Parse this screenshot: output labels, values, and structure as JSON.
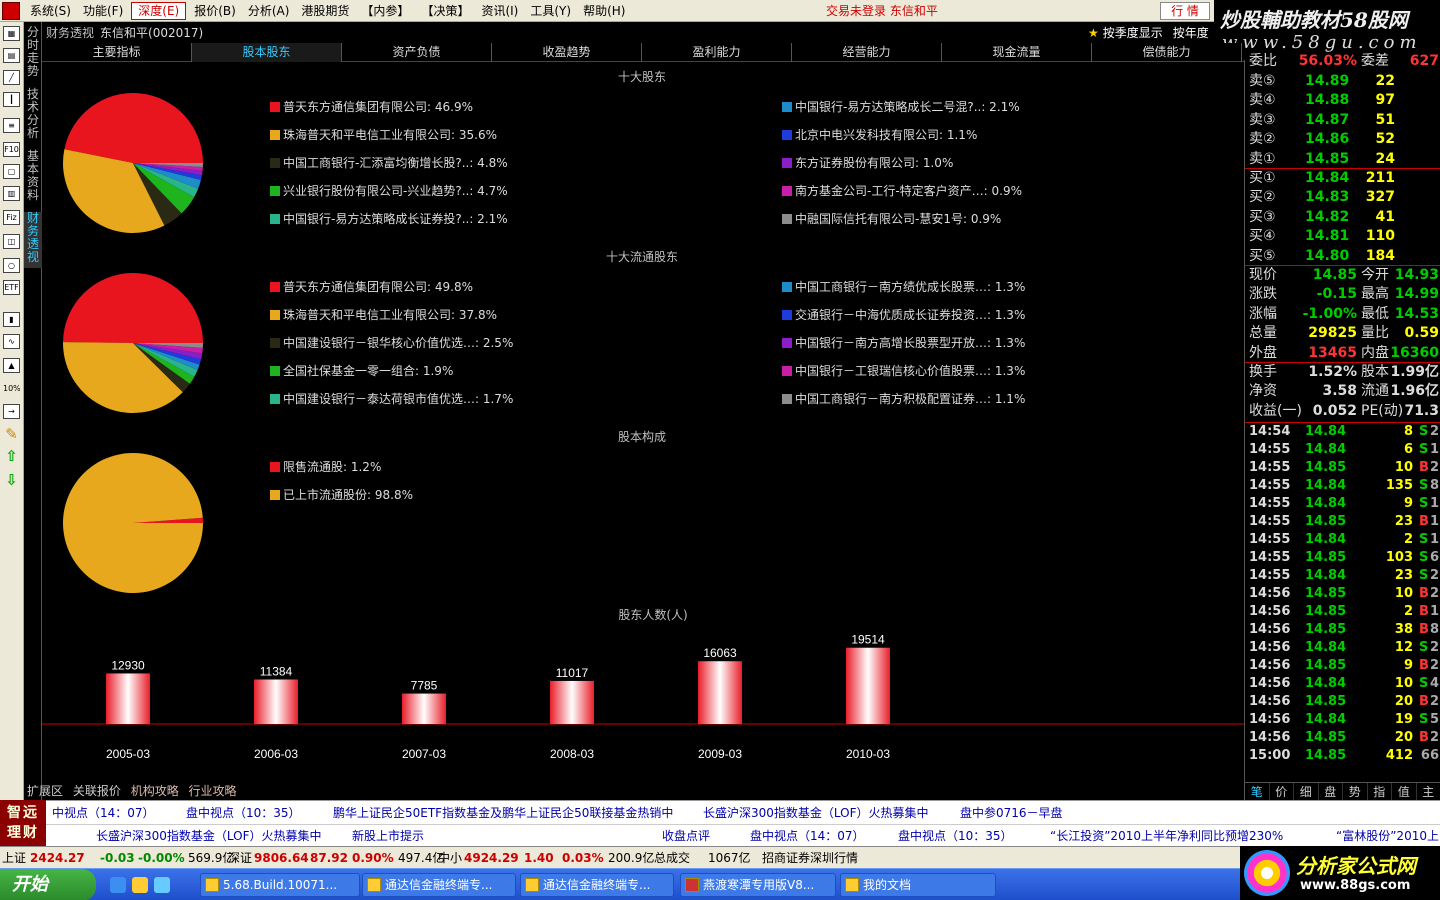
{
  "menu": {
    "items": [
      "系统(S)",
      "功能(F)",
      "深度(E)",
      "报价(B)",
      "分析(A)",
      "港股期货",
      "【内参】",
      "【决策】",
      "资讯(I)",
      "工具(Y)",
      "帮助(H)"
    ],
    "active_index": 2,
    "login_status": "交易未登录  东信和平",
    "quote_button": "行  情"
  },
  "brand_top": {
    "line1": "炒股輔助教材58股网",
    "line2": "www.58gu.com"
  },
  "left_toolbar": {
    "icons": [
      "grid-icon",
      "table-icon",
      "line-chart-icon",
      "kline-icon",
      "list-icon",
      "f10-icon",
      "doc-icon",
      "stack-icon",
      "fiz-icon",
      "f10b-icon",
      "search-icon",
      "etf-icon",
      "bars-icon",
      "wave-icon",
      "chart-icon",
      "percent-icon",
      "export-icon",
      "pencil-icon",
      "arrow-up-icon",
      "arrow-down-icon"
    ],
    "etf_label": "ETF",
    "f10_label": "F10",
    "fiz_label": "Fiz",
    "pct_label": "10%"
  },
  "vtabs": [
    "分时走势",
    "技术分析",
    "基本资料",
    "财务透视"
  ],
  "vtab_active": 3,
  "title": {
    "name": "财务透视",
    "stock": "东信和平(002017)"
  },
  "mode": {
    "season": "按季度显示",
    "year": "按年度"
  },
  "tabs": [
    "主要指标",
    "股本股东",
    "资产负债",
    "收盈趋势",
    "盈利能力",
    "经营能力",
    "现金流量",
    "偿债能力"
  ],
  "tab_active": 1,
  "chart_data": [
    {
      "type": "pie",
      "title": "十大股东",
      "series": [
        {
          "name": "普天东方通信集团有限公司",
          "value": 46.9,
          "color": "#e8141e"
        },
        {
          "name": "珠海普天和平电信工业有限公司",
          "value": 35.6,
          "color": "#e8a81e"
        },
        {
          "name": "中国工商银行-汇添富均衡增长股?..",
          "value": 4.8,
          "color": "#2a2a14"
        },
        {
          "name": "兴业银行股份有限公司-兴业趋势?..",
          "value": 4.7,
          "color": "#1eb41e"
        },
        {
          "name": "中国银行-易方达策略成长证券投?..",
          "value": 2.1,
          "color": "#2ab48c"
        },
        {
          "name": "中国银行-易方达策略成长二号混?..",
          "value": 2.1,
          "color": "#1e8cc8"
        },
        {
          "name": "北京中电兴发科技有限公司",
          "value": 1.1,
          "color": "#1e3cdc"
        },
        {
          "name": "东方证券股份有限公司",
          "value": 1.0,
          "color": "#8c1ec8"
        },
        {
          "name": "南方基金公司-工行-特定客户资产…",
          "value": 0.9,
          "color": "#c81ea8"
        },
        {
          "name": "中融国际信托有限公司-慧安1号",
          "value": 0.9,
          "color": "#8c8c8c"
        }
      ]
    },
    {
      "type": "pie",
      "title": "十大流通股东",
      "series": [
        {
          "name": "普天东方通信集团有限公司",
          "value": 49.8,
          "color": "#e8141e"
        },
        {
          "name": "珠海普天和平电信工业有限公司",
          "value": 37.8,
          "color": "#e8a81e"
        },
        {
          "name": "中国建设银行－银华核心价值优选…",
          "value": 2.5,
          "color": "#2a2a14"
        },
        {
          "name": "全国社保基金一零一组合",
          "value": 1.9,
          "color": "#1eb41e"
        },
        {
          "name": "中国建设银行－泰达荷银市值优选…",
          "value": 1.7,
          "color": "#2ab48c"
        },
        {
          "name": "中国工商银行－南方绩优成长股票…",
          "value": 1.3,
          "color": "#1e8cc8"
        },
        {
          "name": "交通银行－中海优质成长证券投资…",
          "value": 1.3,
          "color": "#1e3cdc"
        },
        {
          "name": "中国银行－南方高增长股票型开放…",
          "value": 1.3,
          "color": "#8c1ec8"
        },
        {
          "name": "中国银行－工银瑞信核心价值股票…",
          "value": 1.3,
          "color": "#c81ea8"
        },
        {
          "name": "中国工商银行－南方积极配置证券…",
          "value": 1.1,
          "color": "#8c8c8c"
        }
      ]
    },
    {
      "type": "pie",
      "title": "股本构成",
      "series": [
        {
          "name": "限售流通股",
          "value": 1.2,
          "color": "#e8141e"
        },
        {
          "name": "已上市流通股份",
          "value": 98.8,
          "color": "#e8a81e"
        }
      ]
    },
    {
      "type": "bar",
      "title": "股东人数(人)",
      "categories": [
        "2005-03",
        "2006-03",
        "2007-03",
        "2008-03",
        "2009-03",
        "2010-03"
      ],
      "values": [
        12930,
        11384,
        7785,
        11017,
        16063,
        19514
      ],
      "ylim": [
        0,
        22000
      ]
    }
  ],
  "quote": {
    "top_partial": {
      "label": "委比",
      "value": "56.03%",
      "label2": "委差",
      "value2": "627"
    },
    "asks": [
      {
        "label": "卖⑤",
        "price": "14.89",
        "vol": "22"
      },
      {
        "label": "卖④",
        "price": "14.88",
        "vol": "97"
      },
      {
        "label": "卖③",
        "price": "14.87",
        "vol": "51"
      },
      {
        "label": "卖②",
        "price": "14.86",
        "vol": "52"
      },
      {
        "label": "卖①",
        "price": "14.85",
        "vol": "24"
      }
    ],
    "bids": [
      {
        "label": "买①",
        "price": "14.84",
        "vol": "211"
      },
      {
        "label": "买②",
        "price": "14.83",
        "vol": "327"
      },
      {
        "label": "买③",
        "price": "14.82",
        "vol": "41"
      },
      {
        "label": "买④",
        "price": "14.81",
        "vol": "110"
      },
      {
        "label": "买⑤",
        "price": "14.80",
        "vol": "184"
      }
    ],
    "stats": [
      {
        "l1": "现价",
        "v1": "14.85",
        "c1": "#0c0",
        "l2": "今开",
        "v2": "14.93",
        "c2": "#0c0"
      },
      {
        "l1": "涨跌",
        "v1": "-0.15",
        "c1": "#0c0",
        "l2": "最高",
        "v2": "14.99",
        "c2": "#0c0"
      },
      {
        "l1": "涨幅",
        "v1": "-1.00%",
        "c1": "#0c0",
        "l2": "最低",
        "v2": "14.53",
        "c2": "#0c0"
      },
      {
        "l1": "总量",
        "v1": "29825",
        "c1": "#ff0",
        "l2": "量比",
        "v2": "0.59",
        "c2": "#ff0"
      },
      {
        "l1": "外盘",
        "v1": "13465",
        "c1": "#f33",
        "l2": "内盘",
        "v2": "16360",
        "c2": "#0c0"
      }
    ],
    "stats2": [
      {
        "l1": "换手",
        "v1": "1.52%",
        "c1": "#ddd",
        "l2": "股本",
        "v2": "1.99亿",
        "c2": "#ddd"
      },
      {
        "l1": "净资",
        "v1": "3.58",
        "c1": "#ddd",
        "l2": "流通",
        "v2": "1.96亿",
        "c2": "#ddd"
      },
      {
        "l1": "收益(一)",
        "v1": "0.052",
        "c1": "#ddd",
        "l2": "PE(动)",
        "v2": "71.3",
        "c2": "#ddd"
      }
    ],
    "ticks": [
      {
        "t": "14:54",
        "p": "14.84",
        "v": "8",
        "f": "S",
        "x": "2"
      },
      {
        "t": "14:55",
        "p": "14.84",
        "v": "6",
        "f": "S",
        "x": "1"
      },
      {
        "t": "14:55",
        "p": "14.85",
        "v": "10",
        "f": "B",
        "x": "2"
      },
      {
        "t": "14:55",
        "p": "14.84",
        "v": "135",
        "f": "S",
        "x": "8"
      },
      {
        "t": "14:55",
        "p": "14.84",
        "v": "9",
        "f": "S",
        "x": "1"
      },
      {
        "t": "14:55",
        "p": "14.85",
        "v": "23",
        "f": "B",
        "x": "1"
      },
      {
        "t": "14:55",
        "p": "14.84",
        "v": "2",
        "f": "S",
        "x": "1"
      },
      {
        "t": "14:55",
        "p": "14.85",
        "v": "103",
        "f": "S",
        "x": "6"
      },
      {
        "t": "14:55",
        "p": "14.84",
        "v": "23",
        "f": "S",
        "x": "2"
      },
      {
        "t": "14:56",
        "p": "14.85",
        "v": "10",
        "f": "B",
        "x": "2"
      },
      {
        "t": "14:56",
        "p": "14.85",
        "v": "2",
        "f": "B",
        "x": "1"
      },
      {
        "t": "14:56",
        "p": "14.85",
        "v": "38",
        "f": "B",
        "x": "8"
      },
      {
        "t": "14:56",
        "p": "14.84",
        "v": "12",
        "f": "S",
        "x": "2"
      },
      {
        "t": "14:56",
        "p": "14.85",
        "v": "9",
        "f": "B",
        "x": "2"
      },
      {
        "t": "14:56",
        "p": "14.84",
        "v": "10",
        "f": "S",
        "x": "4"
      },
      {
        "t": "14:56",
        "p": "14.85",
        "v": "20",
        "f": "B",
        "x": "2"
      },
      {
        "t": "14:56",
        "p": "14.84",
        "v": "19",
        "f": "S",
        "x": "5"
      },
      {
        "t": "14:56",
        "p": "14.85",
        "v": "20",
        "f": "B",
        "x": "2"
      },
      {
        "t": "15:00",
        "p": "14.85",
        "v": "412",
        "f": "",
        "x": "66"
      }
    ],
    "panel_tabs": [
      "笔",
      "价",
      "细",
      "盘",
      "势",
      "指",
      "值",
      "主"
    ]
  },
  "ext_bar": [
    "扩展区",
    "关联报价",
    "机构攻略",
    "行业攻略"
  ],
  "news1": [
    "中视点（14：07）",
    "盘中视点（10：35）",
    "鹏华上证民企50ETF指数基金及鹏华上证民企50联接基金热销中",
    "长盛沪深300指数基金（LOF）火热募集中",
    "盘中参0716－早盘"
  ],
  "news2": [
    "长盛沪深300指数基金（LOF）火热募集中",
    "新股上市提示",
    "收盘点评",
    "盘中视点（14：07）",
    "盘中视点（10：35）",
    "“长江投资”2010上半年净利同比预增230%",
    "“富林股份”2010上"
  ],
  "zhiyuan": "智远理财",
  "index": {
    "sh_label": "上证",
    "sh_value": "2424.27",
    "sh_change": "-0.03",
    "sh_pct": "-0.00%",
    "sh_amount": "569.9亿",
    "sz_label": "深证",
    "sz_value": "9806.64",
    "sz_change": "87.92",
    "sz_pct": "0.90%",
    "sz_amount": "497.4亿",
    "zx_label": "中小",
    "zx_value": "4924.29",
    "zx_change": "1.40",
    "zx_pct": "0.03%",
    "zx_amount": "200.9亿",
    "total_label": "总成交",
    "total_value": "1067亿",
    "broker": "招商证券深圳行情"
  },
  "taskbar": {
    "start": "开始",
    "tasks": [
      "5.68.Build.10071...",
      "通达信金融终端专...",
      "通达信金融终端专...",
      "燕渡寒潭专用版V8...",
      "我的文档"
    ]
  },
  "brand_bottom": {
    "line1": "分析家公式网",
    "line2": "www.88gs.com"
  }
}
